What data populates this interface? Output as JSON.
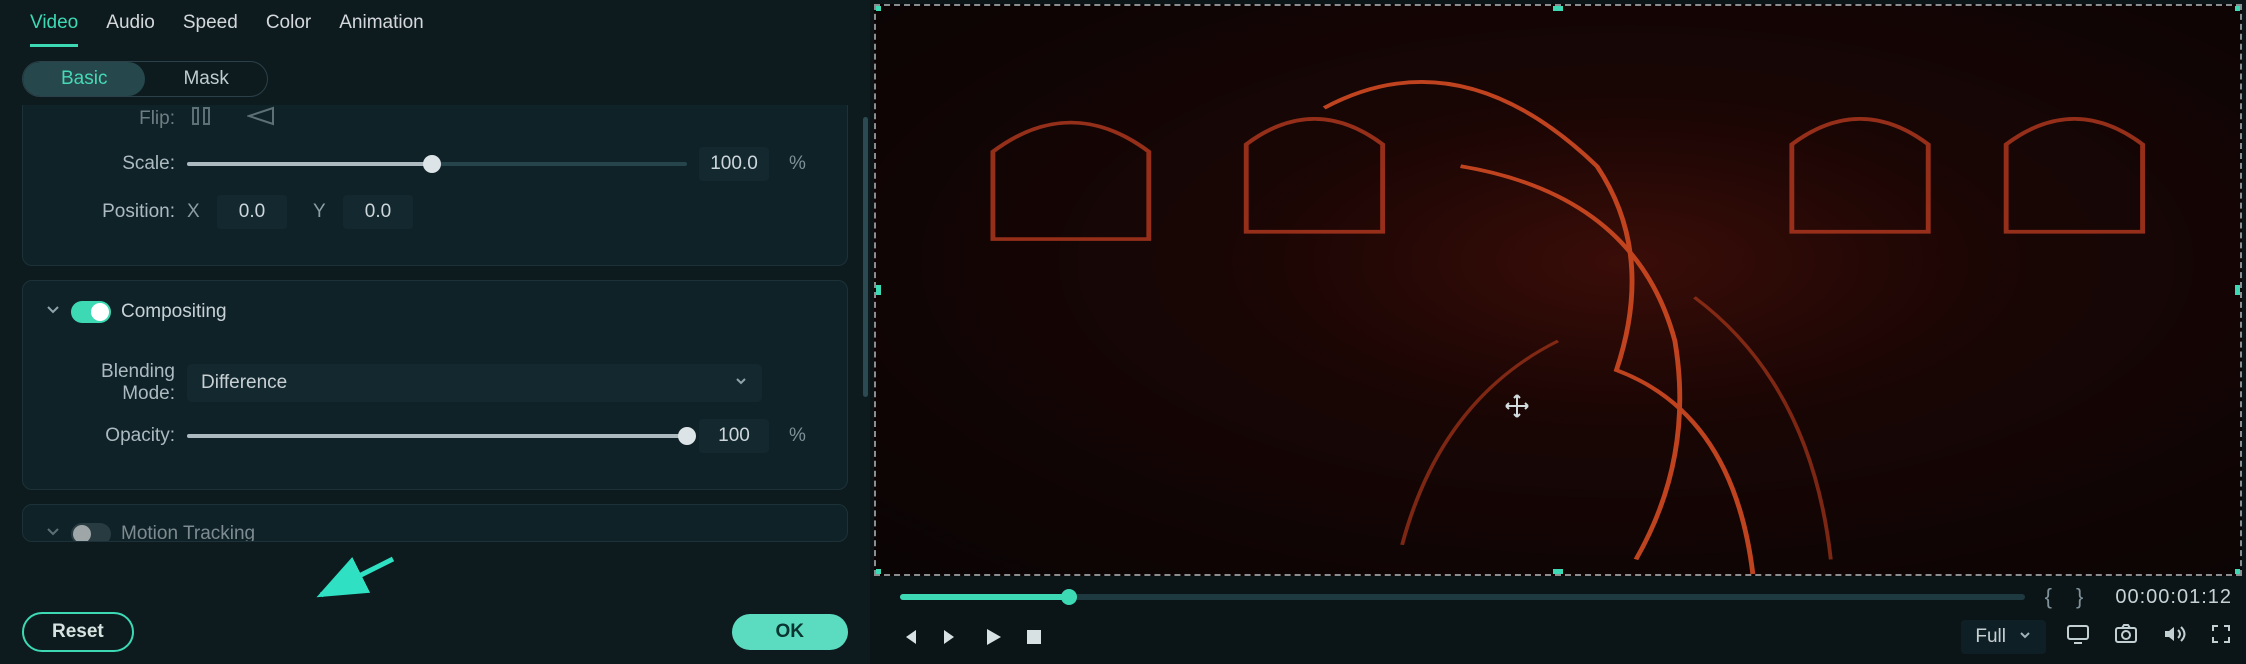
{
  "tabs": {
    "video": "Video",
    "audio": "Audio",
    "speed": "Speed",
    "color": "Color",
    "animation": "Animation"
  },
  "sub_tabs": {
    "basic": "Basic",
    "mask": "Mask"
  },
  "transform": {
    "flip_label": "Flip:",
    "scale_label": "Scale:",
    "scale_value": "100.0",
    "scale_unit": "%",
    "position_label": "Position:",
    "pos_x_label": "X",
    "pos_x_value": "0.0",
    "pos_y_label": "Y",
    "pos_y_value": "0.0"
  },
  "compositing": {
    "title": "Compositing",
    "blend_label": "Blending Mode:",
    "blend_value": "Difference",
    "opacity_label": "Opacity:",
    "opacity_value": "100",
    "opacity_unit": "%"
  },
  "motion_tracking": {
    "title": "Motion Tracking"
  },
  "buttons": {
    "reset": "Reset",
    "ok": "OK"
  },
  "preview": {
    "zoom_label": "Full",
    "timecode": "00:00:01:12",
    "brace_open": "{",
    "brace_close": "}"
  }
}
